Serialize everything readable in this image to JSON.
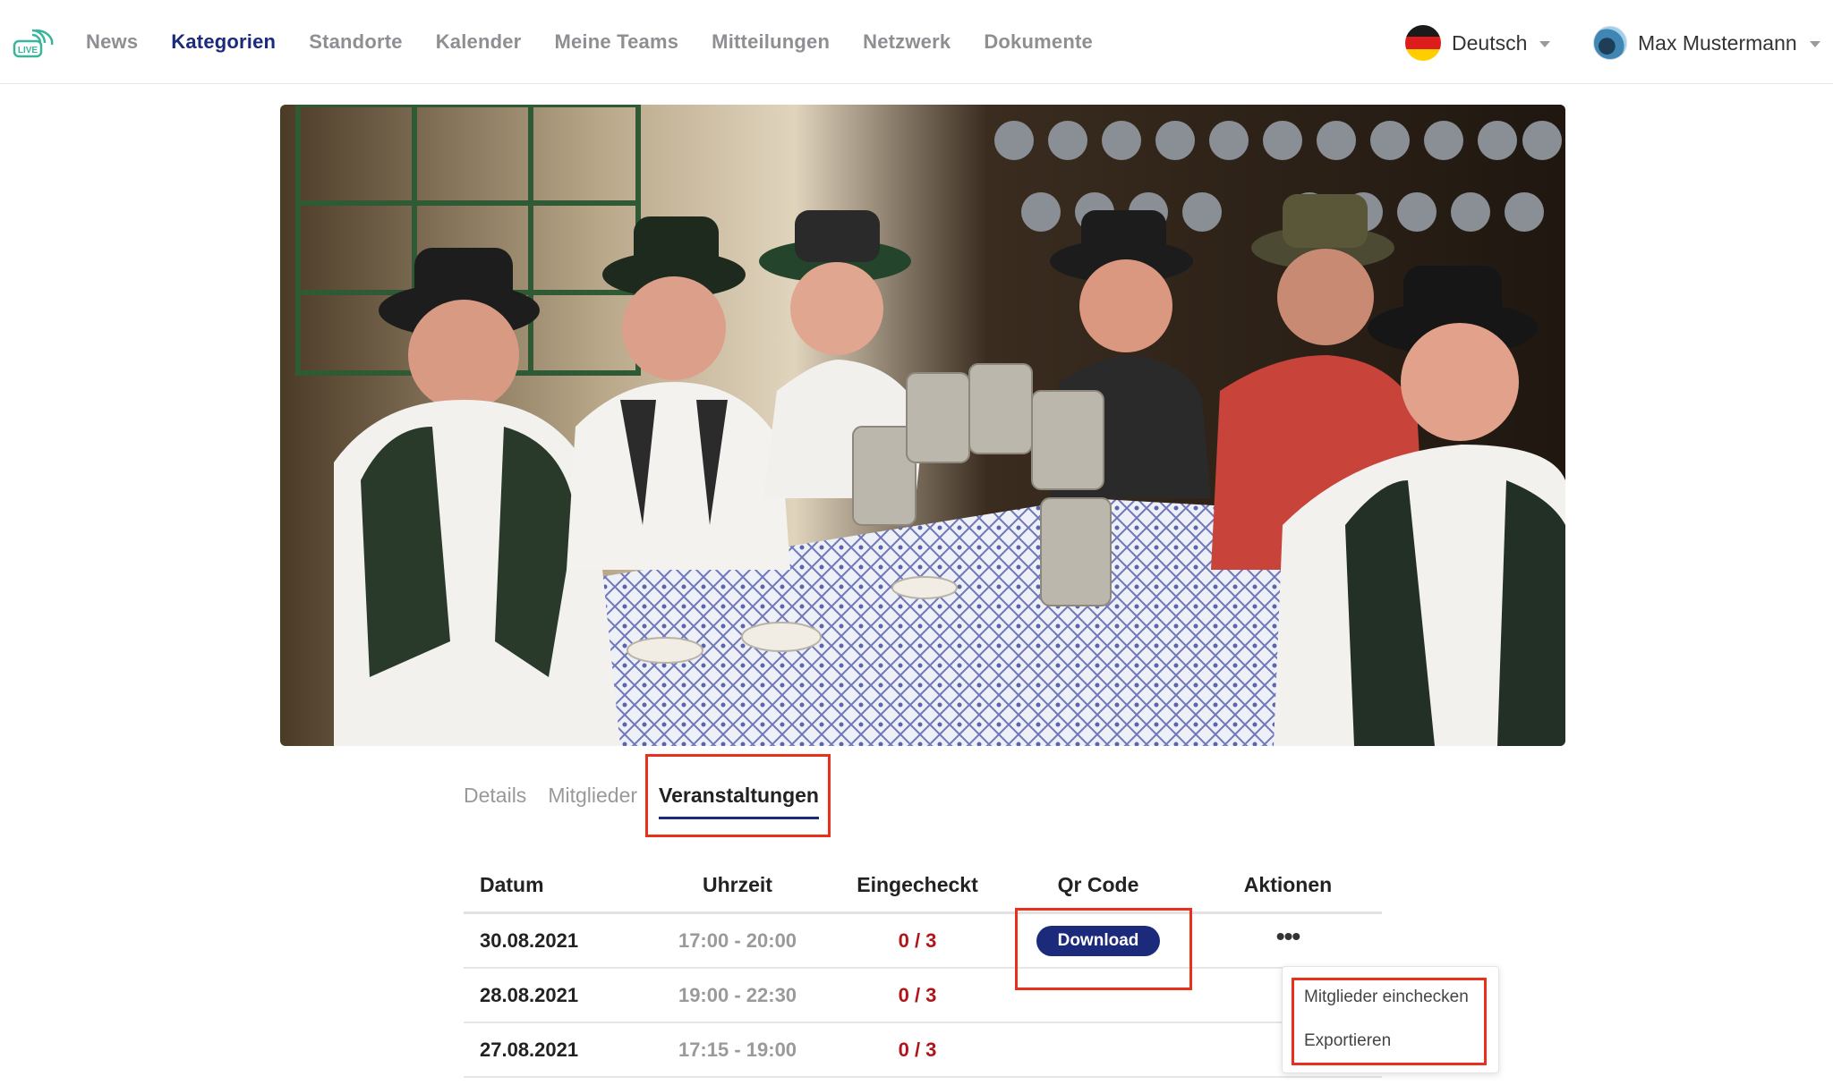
{
  "brand": {
    "logo_text": "LIVE",
    "accent_color": "#1b2a7a",
    "logo_color": "#3ab49a"
  },
  "nav": {
    "items": [
      {
        "label": "News",
        "active": false
      },
      {
        "label": "Kategorien",
        "active": true
      },
      {
        "label": "Standorte",
        "active": false
      },
      {
        "label": "Kalender",
        "active": false
      },
      {
        "label": "Meine Teams",
        "active": false
      },
      {
        "label": "Mitteilungen",
        "active": false
      },
      {
        "label": "Netzwerk",
        "active": false
      },
      {
        "label": "Dokumente",
        "active": false
      }
    ]
  },
  "language": {
    "label": "Deutsch",
    "flag_icon": "german-flag-icon"
  },
  "user": {
    "name": "Max Mustermann",
    "avatar_icon": "avatar-icon"
  },
  "hero": {
    "description_icon": "hero-photo"
  },
  "tabs": [
    {
      "label": "Details",
      "active": false
    },
    {
      "label": "Mitglieder",
      "active": false
    },
    {
      "label": "Veranstaltungen",
      "active": true
    }
  ],
  "table": {
    "headers": [
      "Datum",
      "Uhrzeit",
      "Eingecheckt",
      "Qr Code",
      "Aktionen"
    ],
    "rows": [
      {
        "date": "30.08.2021",
        "time": "17:00 - 20:00",
        "checked": "0 / 3",
        "qr_label": "Download",
        "actions": "•••"
      },
      {
        "date": "28.08.2021",
        "time": "19:00 - 22:30",
        "checked": "0 / 3"
      },
      {
        "date": "27.08.2021",
        "time": "17:15 - 19:00",
        "checked": "0 / 3"
      }
    ]
  },
  "actions_menu": {
    "items": [
      "Mitglieder einchecken",
      "Exportieren"
    ]
  },
  "colors": {
    "checked_status": "#b0151a",
    "highlight": "#e8301a"
  }
}
